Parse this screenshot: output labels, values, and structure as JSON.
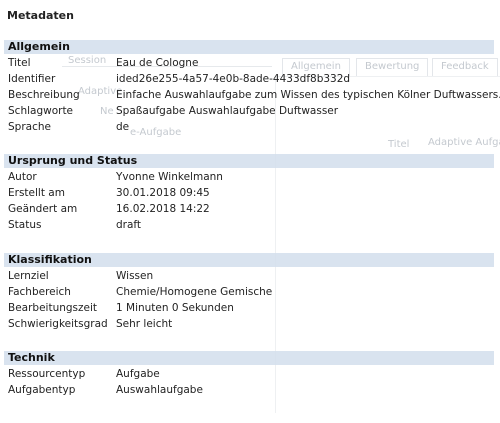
{
  "background": {
    "tab_session": "Session",
    "tab_adaptive": "Adaptive",
    "tab_allgemein": "Allgemein",
    "tab_bewertung": "Bewertung",
    "tab_feedback": "Feedback",
    "item_new": "Ne",
    "item_aufgabe": "e-Aufgabe",
    "col_titel": "Titel",
    "col_adaptive": "Adaptive Aufga"
  },
  "panel": {
    "title": "Metadaten"
  },
  "sections": {
    "allgemein": {
      "header": "Allgemein",
      "rows": [
        {
          "key": "Titel",
          "value": "Eau de Cologne"
        },
        {
          "key": "Identifier",
          "value": "ided26e255-4a57-4e0b-8ade-4433df8b332d"
        },
        {
          "key": "Beschreibung",
          "value": "Einfache Auswahlaufgabe zum Wissen des typischen Kölner Duftwassers."
        },
        {
          "key": "Schlagworte",
          "value": "Spaßaufgabe Auswahlaufgabe Duftwasser"
        },
        {
          "key": "Sprache",
          "value": "de"
        }
      ]
    },
    "ursprung": {
      "header": "Ursprung und Status",
      "rows": [
        {
          "key": "Autor",
          "value": "Yvonne Winkelmann"
        },
        {
          "key": "Erstellt am",
          "value": "30.01.2018 09:45"
        },
        {
          "key": "Geändert am",
          "value": "16.02.2018 14:22"
        },
        {
          "key": "Status",
          "value": "draft"
        }
      ]
    },
    "klassifikation": {
      "header": "Klassifikation",
      "rows": [
        {
          "key": "Lernziel",
          "value": "Wissen"
        },
        {
          "key": "Fachbereich",
          "value": "Chemie/Homogene Gemische"
        },
        {
          "key": "Bearbeitungszeit",
          "value": "1 Minuten 0 Sekunden"
        },
        {
          "key": "Schwierigkeitsgrad",
          "value": "Sehr leicht"
        }
      ]
    },
    "technik": {
      "header": "Technik",
      "rows": [
        {
          "key": "Ressourcentyp",
          "value": "Aufgabe"
        },
        {
          "key": "Aufgabentyp",
          "value": "Auswahlaufgabe"
        }
      ]
    }
  }
}
